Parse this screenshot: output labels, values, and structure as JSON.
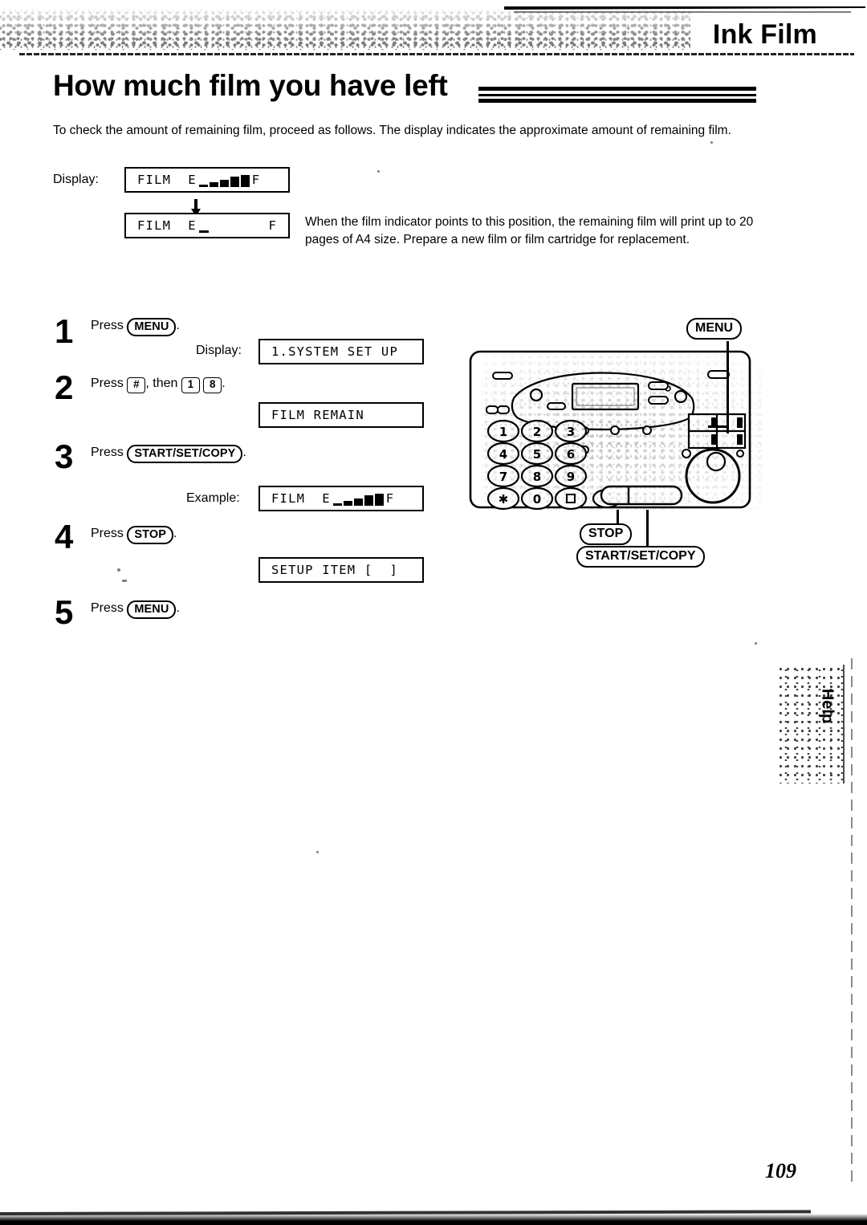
{
  "header": {
    "band_title": "Ink Film"
  },
  "section": {
    "title": "How much film you have left",
    "intro": "To check the amount of remaining film, proceed as follows. The display indicates the approximate amount of remaining film."
  },
  "display_example": {
    "label": "Display:",
    "box_full_prefix": "FILM  E",
    "box_full_suffix": "F",
    "box_low_prefix": "FILM  E",
    "box_low_suffix": "F",
    "note": "When the film indicator points to this position, the remaining film will print up to 20 pages of A4 size. Prepare a new film or film cartridge for replacement."
  },
  "steps": [
    {
      "number": "1",
      "press_label": "Press",
      "button": "MENU",
      "period": ".",
      "result_label": "Display:",
      "result_text": "1.SYSTEM SET UP"
    },
    {
      "number": "2",
      "press_label": "Press",
      "key_hash": "#",
      "then_label": ", then",
      "key_1": "1",
      "key_8": "8",
      "period": ".",
      "result_text": "FILM REMAIN"
    },
    {
      "number": "3",
      "press_label": "Press",
      "button": "START/SET/COPY",
      "period": ".",
      "result_label": "Example:",
      "result_prefix": "FILM  E",
      "result_suffix": "F"
    },
    {
      "number": "4",
      "press_label": "Press",
      "button": "STOP",
      "period": ".",
      "result_text": "SETUP ITEM [  ]"
    },
    {
      "number": "5",
      "press_label": "Press",
      "button": "MENU",
      "period": "."
    }
  ],
  "illustration": {
    "callout_menu": "MENU",
    "callout_stop": "STOP",
    "callout_start": "START/SET/COPY",
    "keypad": [
      [
        "1",
        "2",
        "3"
      ],
      [
        "4",
        "5",
        "6"
      ],
      [
        "7",
        "8",
        "9"
      ],
      [
        "∗",
        "0",
        "□"
      ]
    ]
  },
  "side_tab": {
    "label": "Help"
  },
  "footer": {
    "page_number": "109"
  }
}
